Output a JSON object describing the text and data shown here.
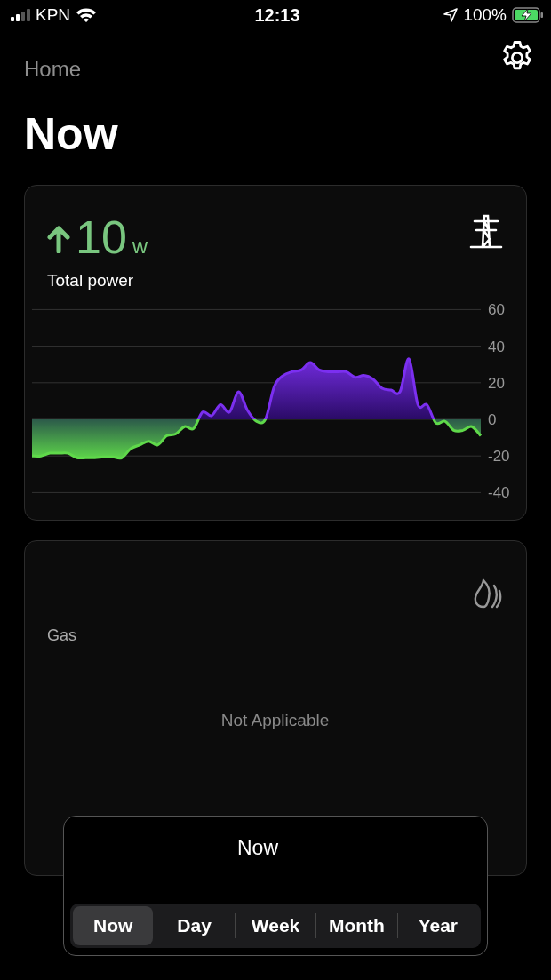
{
  "status_bar": {
    "carrier": "KPN",
    "time": "12:13",
    "battery": "100%"
  },
  "header": {
    "back": "Home",
    "title": "Now"
  },
  "power_card": {
    "value": "10",
    "unit": "w",
    "label": "Total power",
    "chart_data": {
      "type": "area",
      "ylim": [
        -40,
        60
      ],
      "grid": true,
      "yticks": [
        -40,
        -20,
        0,
        20,
        40,
        60
      ],
      "series": [
        {
          "color": "#7b2ff0",
          "values": [
            -20,
            -20,
            -18.5,
            -18.5,
            -18.5,
            -21,
            -21,
            -21,
            -20.5,
            -20.5,
            -21,
            -16,
            -14,
            -12,
            -14,
            -9,
            -8,
            -4,
            -5,
            4,
            2,
            8,
            4,
            15,
            5,
            -1,
            0,
            18,
            24,
            26,
            27,
            31,
            27,
            26,
            26,
            26,
            23,
            24,
            22,
            17,
            16,
            15,
            33,
            8,
            8,
            -2,
            -1,
            -6,
            -6,
            -4,
            -9
          ]
        }
      ]
    }
  },
  "gas_card": {
    "label": "Gas",
    "message": "Not Applicable"
  },
  "period_panel": {
    "title": "Now",
    "segments": [
      {
        "label": "Now",
        "selected": true
      },
      {
        "label": "Day",
        "selected": false
      },
      {
        "label": "Week",
        "selected": false
      },
      {
        "label": "Month",
        "selected": false
      },
      {
        "label": "Year",
        "selected": false
      }
    ]
  }
}
